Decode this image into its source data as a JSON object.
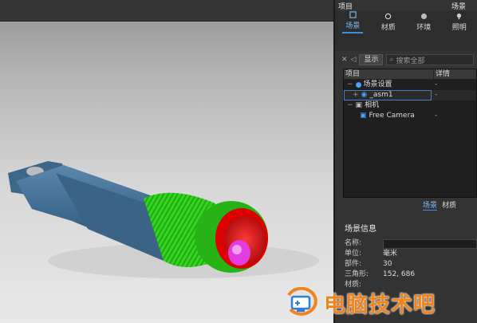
{
  "panel": {
    "header_left": "项目",
    "header_right": "场景",
    "tabs": [
      {
        "label": "场景",
        "icon": "scene-icon",
        "active": true
      },
      {
        "label": "材质",
        "icon": "material-icon",
        "active": false
      },
      {
        "label": "环境",
        "icon": "environment-icon",
        "active": false
      },
      {
        "label": "照明",
        "icon": "lighting-icon",
        "active": false
      }
    ],
    "toolbar": {
      "show_label": "显示",
      "search_placeholder": "搜索全部"
    },
    "tree": {
      "col_project": "项目",
      "col_details": "详情",
      "rows": [
        {
          "label": "场景设置",
          "detail": "-"
        },
        {
          "label": "_asm1",
          "detail": "-"
        },
        {
          "label": "相机",
          "detail": ""
        },
        {
          "label": "Free Camera",
          "detail": "-"
        }
      ]
    },
    "bottom_tabs": [
      "场景",
      "材质"
    ],
    "scene_info": {
      "title": "场景信息",
      "name_label": "名称:",
      "name_value": "",
      "unit_label": "单位:",
      "unit_value": "毫米",
      "parts_label": "部件:",
      "parts_value": "30",
      "triangles_label": "三角形:",
      "triangles_value": "152, 686",
      "materials_label": "材质:"
    }
  },
  "watermark": {
    "text": "电脑技术吧"
  },
  "colors": {
    "accent": "#3a8ee6",
    "knurl_green": "#2ecc1e",
    "body_blue": "#3f6a8f",
    "watermark": "#f0841c"
  }
}
